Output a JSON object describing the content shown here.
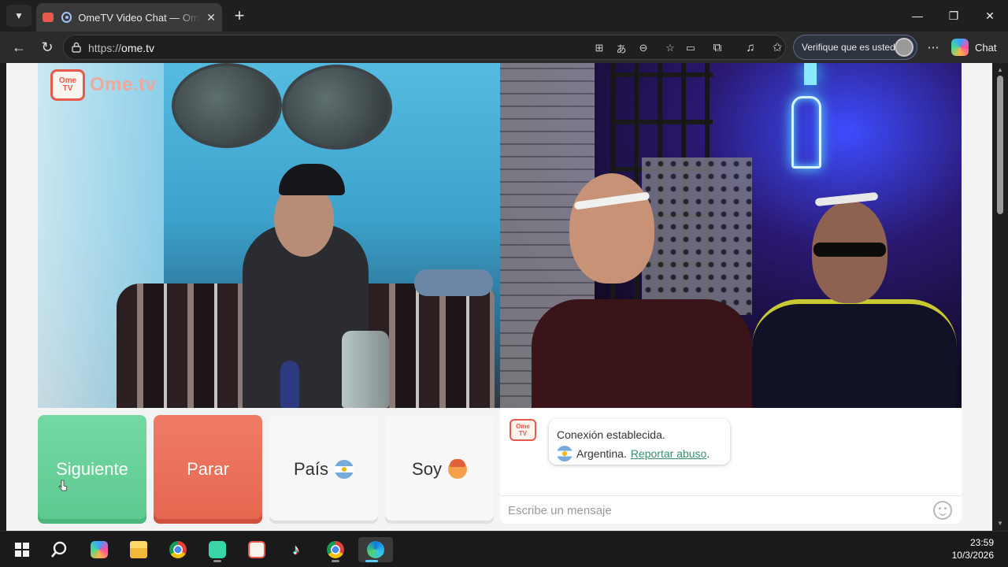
{
  "browser": {
    "tab_title": "OmeTV Video Chat — Omegle",
    "tab_close": "✕",
    "new_tab": "+",
    "url_prefix": "https://",
    "url_host": "ome.tv",
    "profile_label": "Verifique que es usted",
    "copilot_label": "Chat",
    "window_controls": {
      "minimize": "—",
      "restore": "❐",
      "close": "✕"
    }
  },
  "page": {
    "logo_tv_top": "Ome",
    "logo_tv_bottom": "TV",
    "logo_text": "Ome.tv",
    "buttons": {
      "next": "Siguiente",
      "stop": "Parar",
      "country": "País",
      "me": "Soy"
    },
    "chat": {
      "logo_top": "Ome",
      "logo_bottom": "TV",
      "message_line1": "Conexión establecida.",
      "country_name": "Argentina.",
      "report_link": "Reportar abuso",
      "period": ".",
      "input_placeholder": "Escribe un mensaje"
    }
  },
  "taskbar": {
    "time": "23:59",
    "date": "10/3/2026",
    "apps": [
      "start",
      "search",
      "copilot",
      "file-explorer",
      "chrome",
      "app-green",
      "ometv",
      "tiktok",
      "chrome-profile",
      "edge"
    ]
  },
  "colors": {
    "next_button": "#5cc98f",
    "stop_button": "#e5664f",
    "brand": "#e8594c",
    "link": "#3b8f6a"
  }
}
